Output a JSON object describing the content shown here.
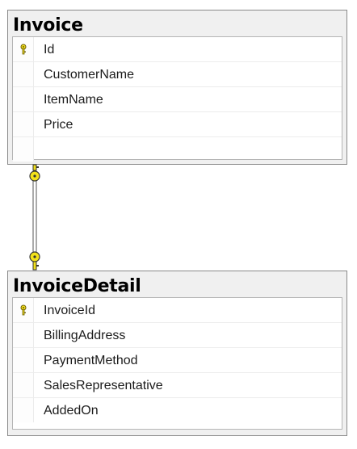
{
  "tables": [
    {
      "title": "Invoice",
      "columns": [
        {
          "name": "Id",
          "primary_key": true
        },
        {
          "name": "CustomerName",
          "primary_key": false
        },
        {
          "name": "ItemName",
          "primary_key": false
        },
        {
          "name": "Price",
          "primary_key": false
        }
      ]
    },
    {
      "title": "InvoiceDetail",
      "columns": [
        {
          "name": "InvoiceId",
          "primary_key": true
        },
        {
          "name": "BillingAddress",
          "primary_key": false
        },
        {
          "name": "PaymentMethod",
          "primary_key": false
        },
        {
          "name": "SalesRepresentative",
          "primary_key": false
        },
        {
          "name": "AddedOn",
          "primary_key": false
        }
      ]
    }
  ],
  "relationship": {
    "type": "one-to-one",
    "from_end_icon": "key-icon",
    "to_end_icon": "key-icon",
    "key_color": "#f3e21a"
  }
}
